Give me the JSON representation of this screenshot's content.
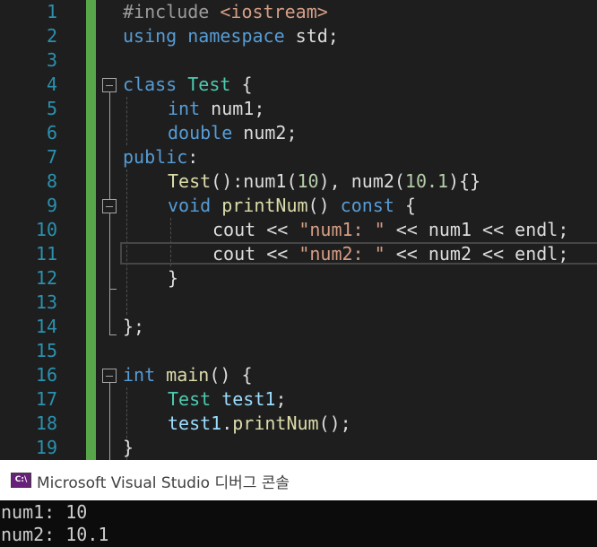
{
  "editor": {
    "line_numbers": [
      "1",
      "2",
      "3",
      "4",
      "5",
      "6",
      "7",
      "8",
      "9",
      "10",
      "11",
      "12",
      "13",
      "14",
      "15",
      "16",
      "17",
      "18",
      "19"
    ],
    "lines": {
      "l1": {
        "a": "#include",
        "b": " ",
        "c": "<iostream>"
      },
      "l2": {
        "a": "using",
        "b": " ",
        "c": "namespace",
        "d": " std;"
      },
      "l4": {
        "a": "class",
        "b": " ",
        "c": "Test",
        "d": " {"
      },
      "l5": {
        "a": "int",
        "b": " num1;"
      },
      "l6": {
        "a": "double",
        "b": " num2;"
      },
      "l7": {
        "a": "public",
        "b": ":"
      },
      "l8": {
        "a": "Test",
        "b": "():num1(",
        "c": "10",
        "d": "), num2(",
        "e": "10.1",
        "f": "){}"
      },
      "l9": {
        "a": "void",
        "b": " ",
        "c": "printNum",
        "d": "() ",
        "e": "const",
        "f": " {"
      },
      "l10": {
        "a": "cout << ",
        "b": "\"num1: \"",
        "c": " << num1 << endl;"
      },
      "l11": {
        "a": "cout << ",
        "b": "\"num2: \"",
        "c": " << num2 << endl;"
      },
      "l12": {
        "a": "}"
      },
      "l14": {
        "a": "};"
      },
      "l16": {
        "a": "int",
        "b": " ",
        "c": "main",
        "d": "() {"
      },
      "l17": {
        "a": "Test",
        "b": " ",
        "c": "test1",
        "d": ";"
      },
      "l18": {
        "a": "test1",
        "b": ".",
        "c": "printNum",
        "d": "();"
      },
      "l19": {
        "a": "}"
      }
    }
  },
  "console": {
    "title": "Microsoft Visual Studio 디버그 콘솔",
    "icon_label": "C:\\",
    "icon_name": "console-app-icon",
    "output": [
      "num1: 10",
      "num2: 10.1"
    ]
  },
  "colors": {
    "background": "#1e1e1e",
    "line_number": "#2b91af",
    "keyword": "#569cd6",
    "type": "#4ec9b0",
    "string": "#d69d85",
    "function": "#dcdcaa",
    "change_bar": "#57a64a",
    "console_bg": "#0c0c0c"
  }
}
